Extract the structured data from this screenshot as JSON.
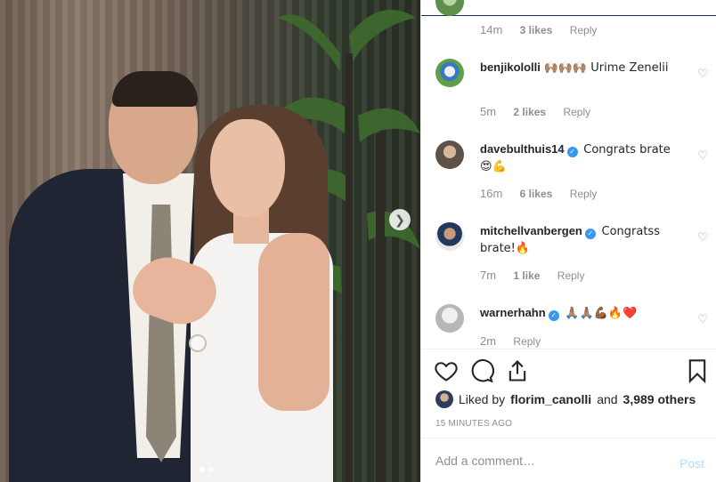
{
  "post": {
    "photo_alt": "",
    "carousel": {
      "current": 1,
      "total": 2
    }
  },
  "comments": [
    {
      "username": "",
      "verified": false,
      "text": "",
      "time": "14m",
      "likes": "3 likes",
      "reply": "Reply",
      "has_heart": false
    },
    {
      "username": "benjikololli",
      "verified": false,
      "text": "🙌🏽🙌🏽🙌🏽 Urime Zenelii",
      "time": "5m",
      "likes": "2 likes",
      "reply": "Reply",
      "has_heart": true
    },
    {
      "username": "davebulthuis14",
      "verified": true,
      "text": "Congrats brate 😍💪",
      "time": "16m",
      "likes": "6 likes",
      "reply": "Reply",
      "has_heart": true
    },
    {
      "username": "mitchellvanbergen",
      "verified": true,
      "text": "Congratss brate!🔥",
      "time": "7m",
      "likes": "1 like",
      "reply": "Reply",
      "has_heart": true
    },
    {
      "username": "warnerhahn",
      "verified": true,
      "text": "🙏🏽🙏🏽💪🏾🔥❤️",
      "time": "2m",
      "likes": "",
      "reply": "Reply",
      "has_heart": true
    }
  ],
  "likes": {
    "prefix": "Liked by",
    "user": "florim_canolli",
    "and": "and",
    "others": "3,989 others"
  },
  "timestamp": "15 MINUTES AGO",
  "add_comment": {
    "placeholder": "Add a comment…",
    "post_label": "Post"
  },
  "colors": {
    "verified": "#3897f0",
    "muted": "#8e8e8e",
    "post_disabled": "#b3dbff"
  },
  "icons": [
    "heart-icon",
    "comment-icon",
    "share-icon",
    "bookmark-icon",
    "chevron-right-icon"
  ]
}
